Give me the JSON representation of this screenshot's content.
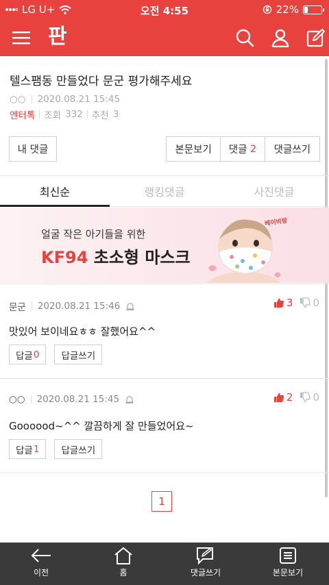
{
  "status_bar": {
    "carrier": "LG U+",
    "time": "오전 4:55",
    "battery": "22%",
    "battery_level": 0.22
  },
  "header": {
    "logo": "판",
    "icons": [
      "menu-icon",
      "search-icon",
      "user-icon",
      "write-icon"
    ]
  },
  "post": {
    "title": "텔스팸동 만들었다 문군 평가해주세요",
    "author": "○○",
    "date": "2020.08.21 15:45",
    "category": "엔터톡",
    "views_label": "조회",
    "views": "332",
    "recommend_label": "추천",
    "recommend": "3"
  },
  "actions": {
    "my_comments": "내 댓글",
    "view_article": "본문보기",
    "comments_label": "댓글",
    "comments_count": "2",
    "write_comment": "댓글쓰기"
  },
  "tabs": [
    {
      "label": "최신순",
      "active": true
    },
    {
      "label": "랭킹댓글",
      "active": false
    },
    {
      "label": "사진댓글",
      "active": false
    }
  ],
  "ad": {
    "line1": "얼굴 작은 아기들을 위한",
    "line2_accent": "KF94",
    "line2_rest": "초소형 마스크",
    "brand": "베이비랑"
  },
  "comments": [
    {
      "author": "문군",
      "date": "2020.08.21 15:46",
      "up": "3",
      "down": "0",
      "text": "맛있어 보이네요ㅎㅎ 잘했어요^^",
      "reply_label": "답글",
      "reply_count": "0",
      "write_reply": "답글쓰기"
    },
    {
      "author": "○○",
      "date": "2020.08.21 15:45",
      "up": "2",
      "down": "0",
      "text": "Goooood~^^ 깔끔하게 잘 만들었어요~",
      "reply_label": "답글",
      "reply_count": "1",
      "write_reply": "답글쓰기"
    }
  ],
  "pagination": {
    "current": "1"
  },
  "bottom_nav": [
    {
      "label": "이전",
      "icon": "back-arrow-icon"
    },
    {
      "label": "홈",
      "icon": "home-icon"
    },
    {
      "label": "댓글쓰기",
      "icon": "comment-write-icon"
    },
    {
      "label": "본문보기",
      "icon": "document-icon"
    }
  ],
  "colors": {
    "brand_red": "#e8423f",
    "nav_dark": "#3a3a3a"
  }
}
